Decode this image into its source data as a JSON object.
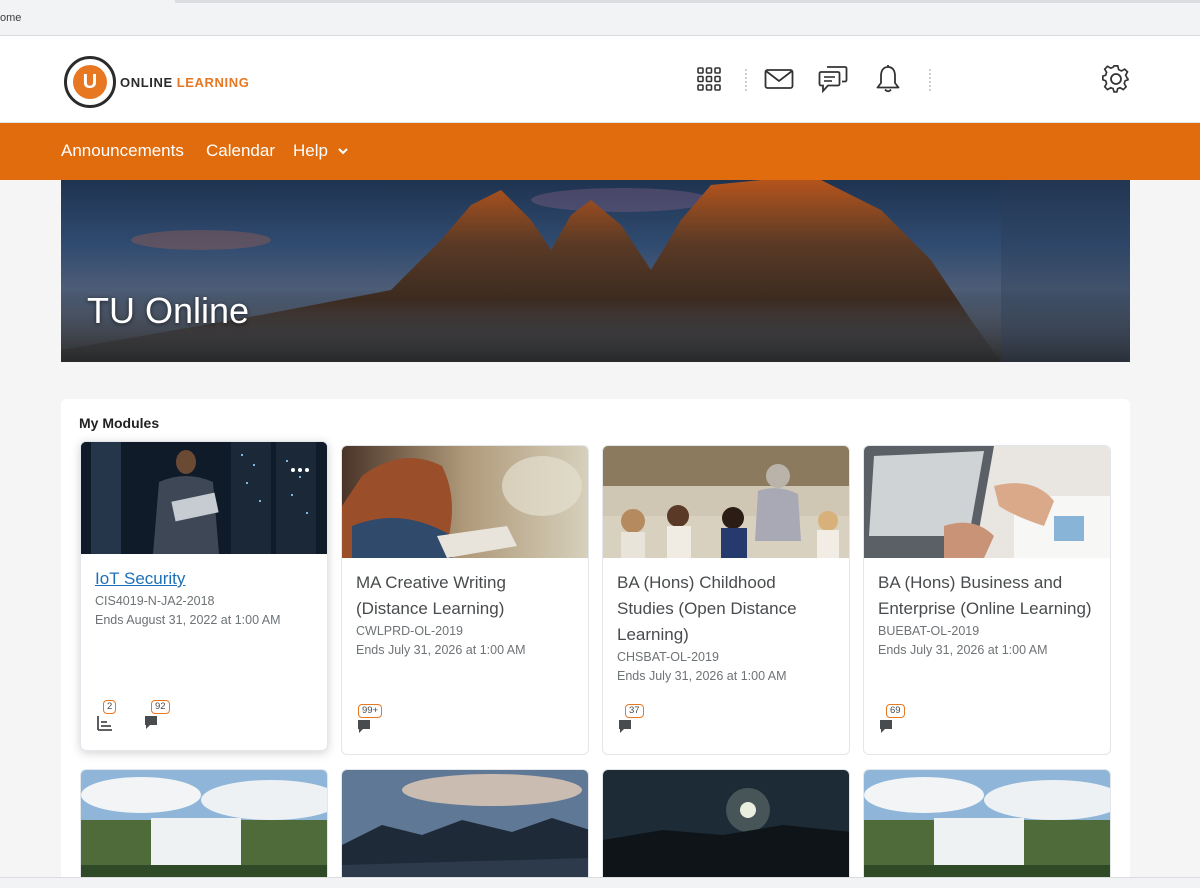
{
  "browser": {
    "address_fragment": "ome"
  },
  "header": {
    "logo_word1": "ONLINE",
    "logo_word2": "LEARNING",
    "logo_letter": "U",
    "icons": [
      "apps-grid-icon",
      "mail-icon",
      "chat-icon",
      "bell-icon",
      "gear-icon"
    ]
  },
  "nav": {
    "items": [
      {
        "label": "Announcements"
      },
      {
        "label": "Calendar"
      },
      {
        "label": "Help"
      }
    ]
  },
  "hero": {
    "title": "TU Online"
  },
  "modules": {
    "title": "My Modules",
    "cards": [
      {
        "name": "IoT Security",
        "code": "CIS4019-N-JA2-2018",
        "ends": "Ends August 31, 2022 at 1:00 AM",
        "badges": [
          {
            "icon": "assignment-icon",
            "count": "2"
          },
          {
            "icon": "discussion-icon",
            "count": "92"
          }
        ]
      },
      {
        "name": "MA Creative Writing (Distance Learning)",
        "code": "CWLPRD-OL-2019",
        "ends": "Ends July 31, 2026 at 1:00 AM",
        "badges": [
          {
            "icon": "discussion-icon",
            "count": "99+"
          }
        ]
      },
      {
        "name": "BA (Hons) Childhood Studies (Open Distance Learning)",
        "code": "CHSBAT-OL-2019",
        "ends": "Ends July 31, 2026 at 1:00 AM",
        "badges": [
          {
            "icon": "discussion-icon",
            "count": "37"
          }
        ]
      },
      {
        "name": "BA (Hons) Business and Enterprise (Online Learning)",
        "code": "BUEBAT-OL-2019",
        "ends": "Ends July 31, 2026 at 1:00 AM",
        "badges": [
          {
            "icon": "discussion-icon",
            "count": "69"
          }
        ]
      }
    ]
  },
  "colors": {
    "brand_orange": "#e06c0e",
    "accent_orange": "#e87722",
    "link_blue": "#1d70b8"
  }
}
